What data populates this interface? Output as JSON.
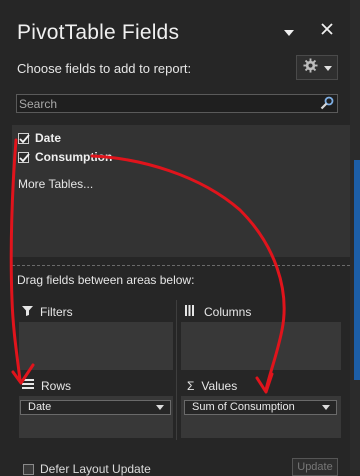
{
  "pane": {
    "title": "PivotTable Fields",
    "subtitle": "Choose fields to add to report:",
    "dropdown_icon": "chevron-down-icon",
    "close_icon": "close-icon",
    "settings_icon": "gear-icon"
  },
  "search": {
    "placeholder": "Search",
    "value": ""
  },
  "fields": [
    {
      "label": "Date",
      "checked": true
    },
    {
      "label": "Consumption",
      "checked": true
    }
  ],
  "more_tables": "More Tables...",
  "areas_caption": "Drag fields between areas below:",
  "areas": {
    "filters": {
      "label": "Filters",
      "icon": "filter-icon"
    },
    "columns": {
      "label": "Columns",
      "icon": "columns-icon"
    },
    "rows": {
      "label": "Rows",
      "icon": "rows-icon",
      "item": "Date"
    },
    "values": {
      "label": "Values",
      "icon": "sigma-icon",
      "symbol": "Σ",
      "item": "Sum of Consumption"
    }
  },
  "footer": {
    "defer_label": "Defer Layout Update",
    "update_label": "Update"
  },
  "colors": {
    "background": "#262626",
    "panel": "#333333",
    "area": "#383838",
    "annotation": "#e0141c",
    "scroll_accent": "#1d5fa8"
  }
}
